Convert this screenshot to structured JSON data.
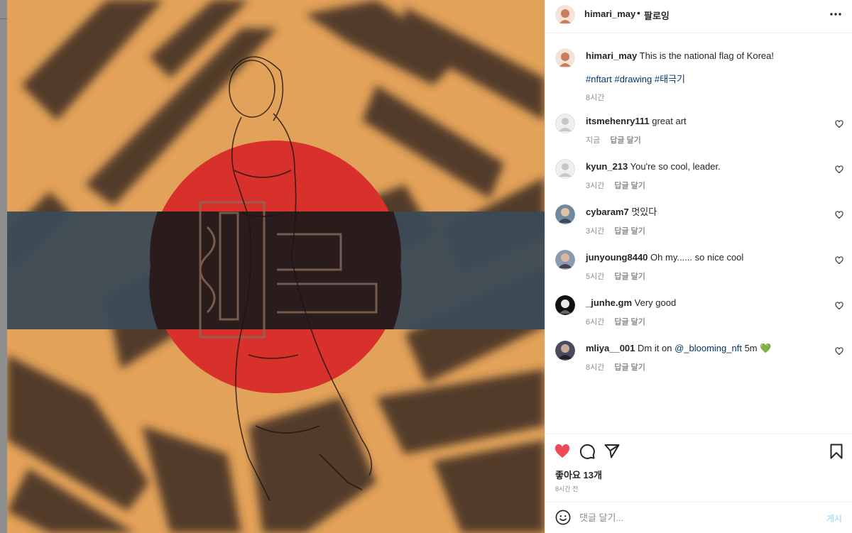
{
  "post": {
    "author": "himari_may",
    "follow_status": "팔로잉",
    "caption": "This is the national flag of Korea!",
    "hashtags": "#nftart #drawing #태극기",
    "caption_time": "8시간",
    "likes_label": "좋아요 13개",
    "posted_label": "8시간 전"
  },
  "reply_label": "답글 달기",
  "comments": [
    {
      "user": "itsmehenry111",
      "text": "great art",
      "time": "지금"
    },
    {
      "user": "kyun_213",
      "text": "You're so cool, leader.",
      "time": "3시간"
    },
    {
      "user": "cybaram7",
      "text": "멋있다",
      "time": "3시간"
    },
    {
      "user": "junyoung8440",
      "text": "Oh my...... so nice cool",
      "time": "5시간"
    },
    {
      "user": "_junhe.gm",
      "text": "Very good",
      "time": "6시간"
    },
    {
      "user": "mliya__001",
      "text": "Dm it on",
      "mention": "@_blooming_nft",
      "suffix": "5m 💚",
      "time": "8시간"
    }
  ],
  "comment_box": {
    "placeholder": "댓글 달기...",
    "post_label": "게시"
  },
  "icons": [
    "more-icon",
    "heart-filled-icon",
    "comment-icon",
    "share-icon",
    "bookmark-icon",
    "emoji-icon",
    "like-icon"
  ],
  "colors": {
    "liked": "#ed4956",
    "link": "#00376b",
    "muted": "#8e8e8e",
    "post_disabled": "#b2dffc"
  }
}
